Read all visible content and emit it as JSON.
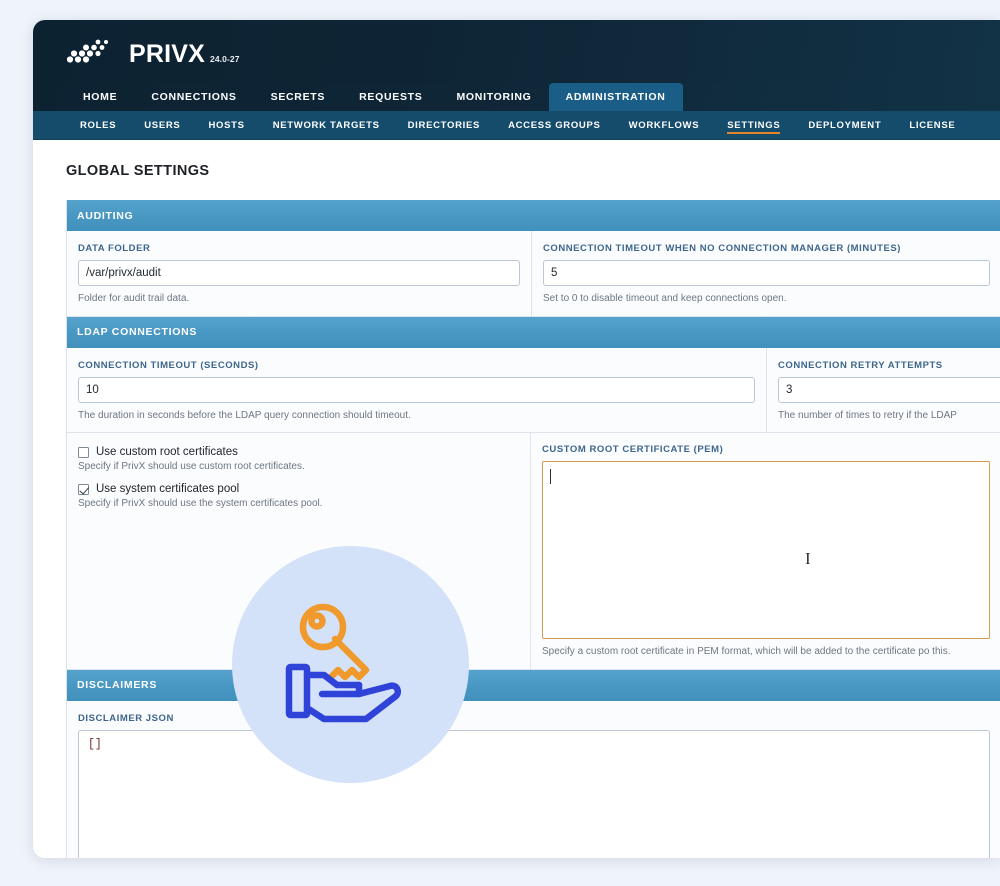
{
  "brand": {
    "name": "PRIVX",
    "version": "24.0-27",
    "logo_icon": "privx-dots-logo",
    "accent_orange": "#e4842a",
    "nav_dark": "#0d2231",
    "nav_active": "#1a5d86",
    "subnav_blue": "#154c6c",
    "section_header_blue": "#4897c3"
  },
  "nav_primary": [
    {
      "label": "HOME",
      "active": false
    },
    {
      "label": "CONNECTIONS",
      "active": false
    },
    {
      "label": "SECRETS",
      "active": false
    },
    {
      "label": "REQUESTS",
      "active": false
    },
    {
      "label": "MONITORING",
      "active": false
    },
    {
      "label": "ADMINISTRATION",
      "active": true
    }
  ],
  "nav_secondary": [
    {
      "label": "ROLES",
      "active": false
    },
    {
      "label": "USERS",
      "active": false
    },
    {
      "label": "HOSTS",
      "active": false
    },
    {
      "label": "NETWORK TARGETS",
      "active": false
    },
    {
      "label": "DIRECTORIES",
      "active": false
    },
    {
      "label": "ACCESS GROUPS",
      "active": false
    },
    {
      "label": "WORKFLOWS",
      "active": false
    },
    {
      "label": "SETTINGS",
      "active": true
    },
    {
      "label": "DEPLOYMENT",
      "active": false
    },
    {
      "label": "LICENSE",
      "active": false
    }
  ],
  "page": {
    "title": "GLOBAL SETTINGS"
  },
  "sections": {
    "auditing": {
      "header": "AUDITING",
      "data_folder": {
        "label": "DATA FOLDER",
        "value": "/var/privx/audit",
        "help": "Folder for audit trail data."
      },
      "connection_timeout": {
        "label": "CONNECTION TIMEOUT WHEN NO CONNECTION MANAGER (MINUTES)",
        "value": "5",
        "help": "Set to 0 to disable timeout and keep connections open."
      }
    },
    "ldap": {
      "header": "LDAP CONNECTIONS",
      "connection_timeout": {
        "label": "CONNECTION TIMEOUT (SECONDS)",
        "value": "10",
        "help": "The duration in seconds before the LDAP query connection should timeout."
      },
      "retry_attempts": {
        "label": "CONNECTION RETRY ATTEMPTS",
        "value": "3",
        "help": "The number of times to retry if the LDAP "
      },
      "use_custom_root_certificates": {
        "label": "Use custom root certificates",
        "checked": false,
        "help": "Specify if PrivX should use custom root certificates."
      },
      "use_system_certificates_pool": {
        "label": "Use system certificates pool",
        "checked": true,
        "help": "Specify if PrivX should use the system certificates pool."
      },
      "custom_root_certificate": {
        "label": "CUSTOM ROOT CERTIFICATE (PEM)",
        "value": "",
        "help": "Specify a custom root certificate in PEM format, which will be added to the certificate po this."
      }
    },
    "disclaimers": {
      "header": "DISCLAIMERS",
      "disclaimer_json": {
        "label": "DISCLAIMER JSON",
        "value": "[]"
      }
    }
  },
  "overlay": {
    "icon": "key-in-hand-icon",
    "circle_color": "#d3e2f8",
    "key_color": "#f0992c",
    "hand_color": "#2f43d8"
  },
  "cursors": {
    "text_caret": "|",
    "mouse_ibeam": "I"
  }
}
